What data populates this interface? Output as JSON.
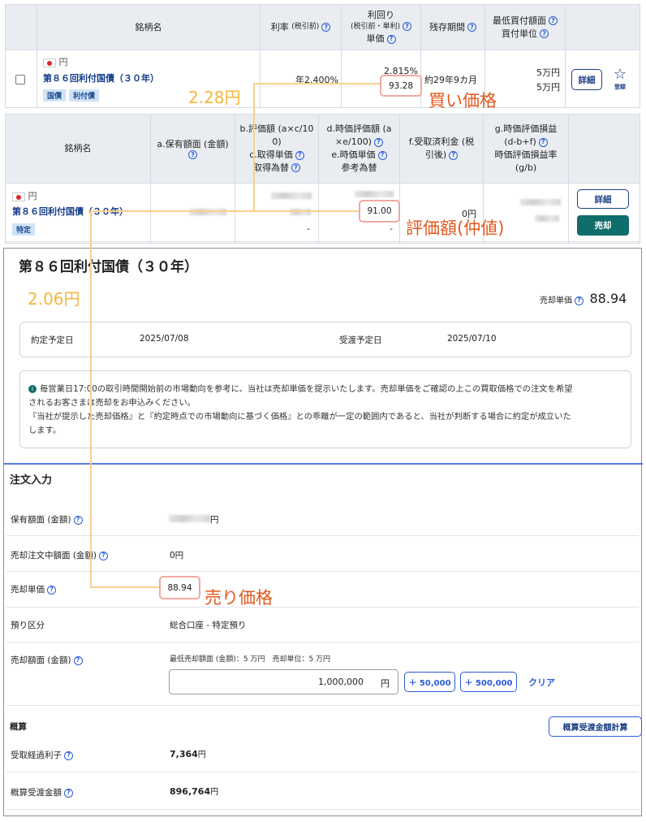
{
  "panel1": {
    "headers": {
      "name": "銘柄名",
      "rate": "利率",
      "rate_sub": "(税引前)",
      "yield_l1": "利回り",
      "yield_l2": "(税引前・単利)",
      "yield_l3": "単価",
      "term": "残存期間",
      "min_l1": "最低買付額面",
      "min_l2": "買付単位"
    },
    "row": {
      "currency": "円",
      "name": "第８６回利付国債（３０年）",
      "tags": [
        "国債",
        "利付債"
      ],
      "rate": "年2.400%",
      "yield": "2.815%",
      "price": "93.28",
      "term": "約29年9カ月",
      "min_amount": "5万円",
      "unit": "5万円",
      "detail_button": "詳細",
      "register_label": "登録"
    }
  },
  "panel2": {
    "headers": {
      "name": "銘柄名",
      "a_l1": "a.保有額面 (金額)",
      "b_l1": "b.評価額 (a×c/10",
      "b_l2": "0)",
      "b_l3": "c.取得単価",
      "b_l4": "取得為替",
      "d_l1": "d.時価評価額 (a",
      "d_l2": "×e/100)",
      "d_l3": "e.時価単価",
      "d_l4": "参考為替",
      "f_l1": "f.受取済利金 (税",
      "f_l2": "引後)",
      "g_l1": "g.時価評価損益",
      "g_l2": "(d-b+f)",
      "g_l3": "時価評価損益率",
      "g_l4": "(g/b)"
    },
    "row": {
      "currency": "円",
      "name": "第８６回利付国債（３０年）",
      "tag": "特定",
      "dash1": "-",
      "dash2": "-",
      "market_price": "91.00",
      "received_interest": "0円",
      "detail_button": "詳細",
      "sell_button": "売却"
    }
  },
  "panel3": {
    "title": "第８６回利付国債（３０年）",
    "sell_price_label": "売却単価",
    "sell_price": "88.94",
    "contract_date_label": "約定予定日",
    "contract_date": "2025/07/08",
    "delivery_date_label": "受渡予定日",
    "delivery_date": "2025/07/10",
    "notice_l1": "毎営業日17:00の取引時間開始前の市場動向を参考に、当社は売却単価を提示いたします。売却単価をご確認の上この買取価格での注文を希望",
    "notice_l2": "されるお客さまは売却をお申込みください。",
    "notice_l3": "『当社が提示した売却価格』と『約定時点での市場動向に基づく価格』との乖離が一定の範囲内であると、当社が判断する場合に約定が成立いた",
    "notice_l4": "します。",
    "order_heading": "注文入力",
    "holding_label": "保有額面 (金額)",
    "holding_suffix": "円",
    "selling_amount_label": "売却注文中額面 (金額)",
    "selling_amount": "0円",
    "unit_price_label": "売却単価",
    "unit_price": "88.94",
    "custody_label": "預り区分",
    "custody_value": "総合口座 - 特定預り",
    "sell_face_label": "売却額面 (金額)",
    "sell_face_hint": "最低売却額面 (金額)：5 万円　売却単位：5 万円",
    "sell_face_value": "1,000,000",
    "sell_face_unit": "円",
    "plus_50k": "＋ 50,000",
    "plus_500k": "＋ 500,000",
    "clear": "クリア",
    "estimate_heading": "概算",
    "calc_button": "概算受渡金額計算",
    "accrued_label": "受取経過利子",
    "accrued_value": "7,364",
    "accrued_unit": "円",
    "settlement_label": "概算受渡金額",
    "settlement_value": "896,764",
    "settlement_unit": "円"
  },
  "annotations": {
    "buy_price": "買い価格",
    "mid_price": "評価額(仲値)",
    "sell_price": "売り価格",
    "diff_buy": "2.28円",
    "diff_sell": "2.06円"
  },
  "colors": {
    "header_bg": "#e9edf2",
    "link_blue": "#123a8a",
    "accent_green": "#0f6e6c",
    "annotation_orange": "#e2581e",
    "annotation_yellow": "#f6b53a"
  }
}
